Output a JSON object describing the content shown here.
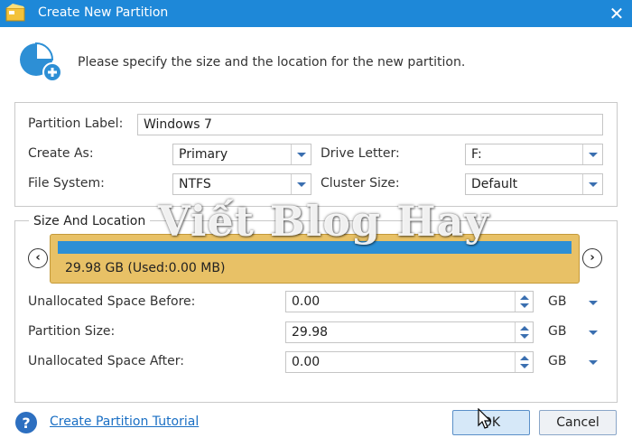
{
  "window": {
    "title": "Create New Partition"
  },
  "instruction": "Please specify the size and the location for the new partition.",
  "form": {
    "partition_label": {
      "label": "Partition Label:",
      "value": "Windows 7"
    },
    "create_as": {
      "label": "Create As:",
      "value": "Primary"
    },
    "drive_letter": {
      "label": "Drive Letter:",
      "value": "F:"
    },
    "file_system": {
      "label": "File System:",
      "value": "NTFS"
    },
    "cluster_size": {
      "label": "Cluster Size:",
      "value": "Default"
    }
  },
  "size_location": {
    "legend": "Size And Location",
    "disk_bar": {
      "info": "29.98 GB (Used:0.00 MB)",
      "fill_fraction": 1.0,
      "used_color": "#2d8fd5",
      "background_color": "#e8c166"
    },
    "unallocated_before": {
      "label": "Unallocated Space Before:",
      "value": "0.00",
      "unit": "GB"
    },
    "partition_size": {
      "label": "Partition Size:",
      "value": "29.98",
      "unit": "GB"
    },
    "unallocated_after": {
      "label": "Unallocated Space After:",
      "value": "0.00",
      "unit": "GB"
    }
  },
  "watermark": "Viết Blog Hay",
  "footer": {
    "tutorial_link": "Create Partition Tutorial",
    "ok_label": "OK",
    "cancel_label": "Cancel"
  },
  "icons": {
    "app": "minitool-app-icon",
    "header": "partition-add-icon",
    "close": "close-icon",
    "help": "help-icon",
    "left": "chevron-left-icon",
    "right": "chevron-right-icon"
  },
  "colors": {
    "titlebar": "#1e88d8",
    "accent": "#2d8fd5",
    "link": "#1a6fc4"
  }
}
